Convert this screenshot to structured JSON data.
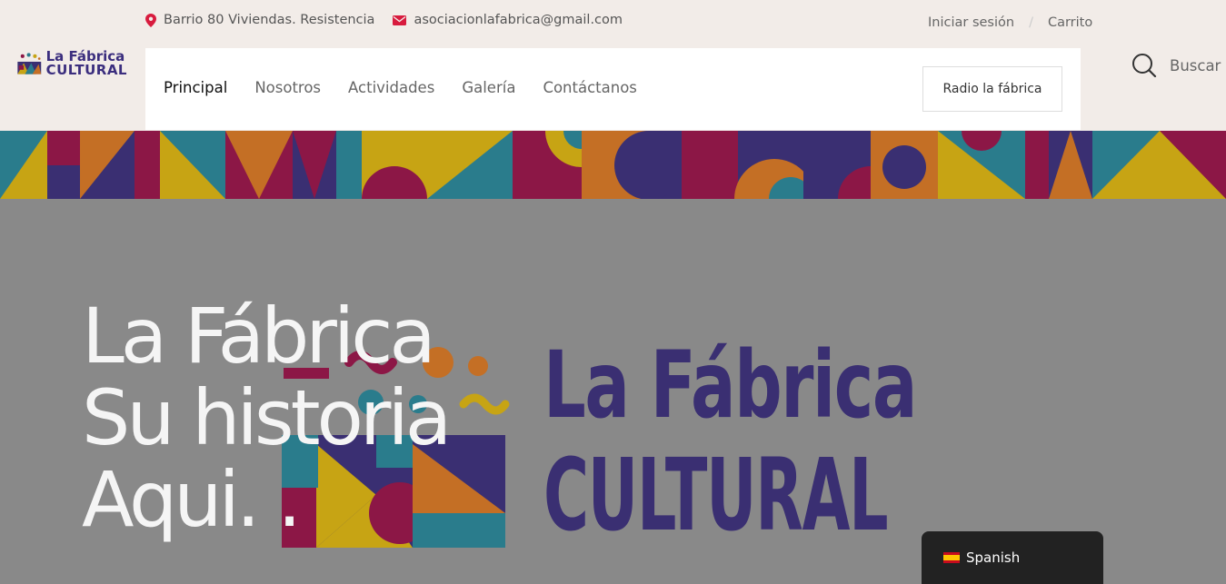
{
  "logo": {
    "line1": "La Fábrica",
    "line2": "CULTURAL"
  },
  "topbar": {
    "address": "Barrio 80 Viviendas. Resistencia",
    "email": "asociacionlafabrica@gmail.com",
    "login": "Iniciar sesión",
    "separator": "/",
    "cart": "Carrito"
  },
  "nav": {
    "items": [
      "Principal",
      "Nosotros",
      "Actividades",
      "Galería",
      "Contáctanos"
    ],
    "radio_button": "Radio la fábrica"
  },
  "search": {
    "label": "Buscar",
    "icon": "search-icon"
  },
  "hero": {
    "line1": "La Fábrica",
    "line2": "Su historia",
    "line3": "Aqui. ."
  },
  "wordmark": {
    "line1": "La Fábrica",
    "line2": "CULTURAL"
  },
  "language": {
    "label": "Spanish",
    "flag": "es-flag"
  },
  "colors": {
    "header_bg": "#f2ece8",
    "hero_bg": "#898989",
    "brand_purple": "#3a2f72",
    "icon_red": "#d81b3e",
    "magenta": "#8c1746",
    "teal": "#2a7c8c",
    "yellow": "#c7a414",
    "orange": "#c46f25"
  }
}
